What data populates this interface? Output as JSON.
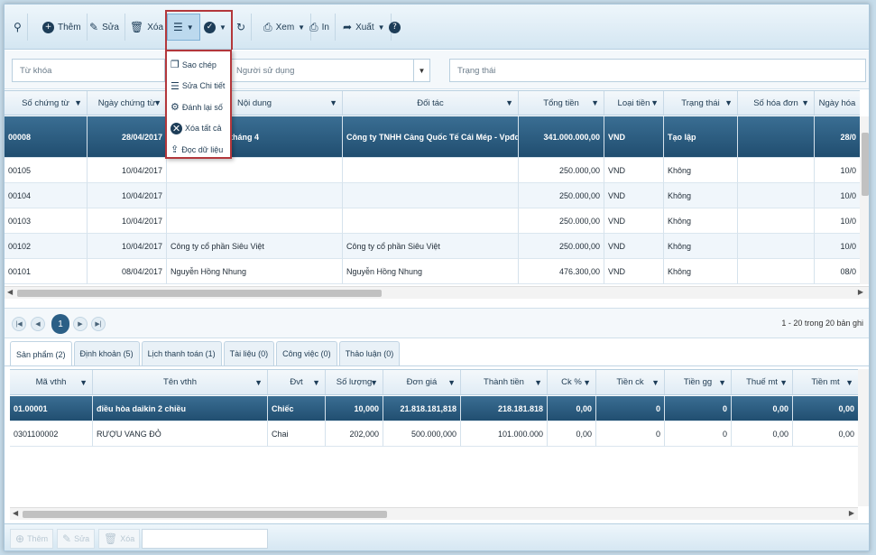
{
  "toolbar": {
    "add_label": "Thêm",
    "edit_label": "Sửa",
    "delete_label": "Xóa",
    "view_label": "Xem",
    "print_label": "In",
    "export_label": "Xuất"
  },
  "menu": {
    "items": [
      {
        "label": "Sao chép",
        "icon": "copy-icon"
      },
      {
        "label": "Sửa Chi tiết",
        "icon": "list-icon"
      },
      {
        "label": "Đánh lại số",
        "icon": "gears-icon"
      },
      {
        "label": "Xóa tất cả",
        "icon": "close-circle-icon"
      },
      {
        "label": "Đọc dữ liệu",
        "icon": "upload-icon"
      }
    ]
  },
  "filters": {
    "keyword_placeholder": "Từ khóa",
    "user_placeholder": "Người sử dụng",
    "status_placeholder": "Trạng thái"
  },
  "main_grid": {
    "columns": [
      "Số chứng từ",
      "Ngày chứng từ",
      "Nội dung",
      "Đối tác",
      "Tổng tiền",
      "Loại tiền",
      "Trạng thái",
      "Số hóa đơn",
      "Ngày hóa"
    ],
    "rows": [
      [
        "00008",
        "28/04/2017",
        "tháng 4",
        "Công ty TNHH Cảng Quốc Tế Cái Mép - Vpđd",
        "341.000.000,00",
        "VND",
        "Tạo lập",
        "",
        "28/0"
      ],
      [
        "00105",
        "10/04/2017",
        "",
        "",
        "250.000,00",
        "VND",
        "Không",
        "",
        "10/0"
      ],
      [
        "00104",
        "10/04/2017",
        "",
        "",
        "250.000,00",
        "VND",
        "Không",
        "",
        "10/0"
      ],
      [
        "00103",
        "10/04/2017",
        "",
        "",
        "250.000,00",
        "VND",
        "Không",
        "",
        "10/0"
      ],
      [
        "00102",
        "10/04/2017",
        "Công ty cổ phần Siêu Việt",
        "Công ty cổ phần Siêu Việt",
        "250.000,00",
        "VND",
        "Không",
        "",
        "10/0"
      ],
      [
        "00101",
        "08/04/2017",
        "Nguyễn Hồng Nhung",
        "Nguyễn Hồng Nhung",
        "476.300,00",
        "VND",
        "Không",
        "",
        "08/0"
      ]
    ]
  },
  "pager": {
    "current_page": "1",
    "info": "1 - 20 trong 20 bản ghi"
  },
  "tabs": [
    "Sản phẩm (2)",
    "Định khoản (5)",
    "Lịch thanh toán (1)",
    "Tài liệu (0)",
    "Công việc (0)",
    "Thảo luận (0)"
  ],
  "detail_grid": {
    "columns": [
      "Mã vthh",
      "Tên vthh",
      "Đvt",
      "Số lượng",
      "Đơn giá",
      "Thành tiền",
      "Ck %",
      "Tiền ck",
      "Tiền gg",
      "Thuế mt",
      "Tiền mt"
    ],
    "rows": [
      [
        "01.00001",
        "điều hòa daikin 2 chiều",
        "Chiếc",
        "10,000",
        "21.818.181,818",
        "218.181.818",
        "0,00",
        "0",
        "0",
        "0,00",
        "0,00"
      ],
      [
        "0301100002",
        "RƯỢU VANG ĐỎ",
        "Chai",
        "202,000",
        "500.000,000",
        "101.000.000",
        "0,00",
        "0",
        "0",
        "0,00",
        "0,00"
      ]
    ]
  },
  "bottom_bar": {
    "add_label": "Thêm",
    "edit_label": "Sửa",
    "delete_label": "Xóa"
  },
  "colors": {
    "selected_row": "#2b5f86",
    "menu_border": "#b3373b",
    "toolbar_bg": "#dbeaf4"
  }
}
